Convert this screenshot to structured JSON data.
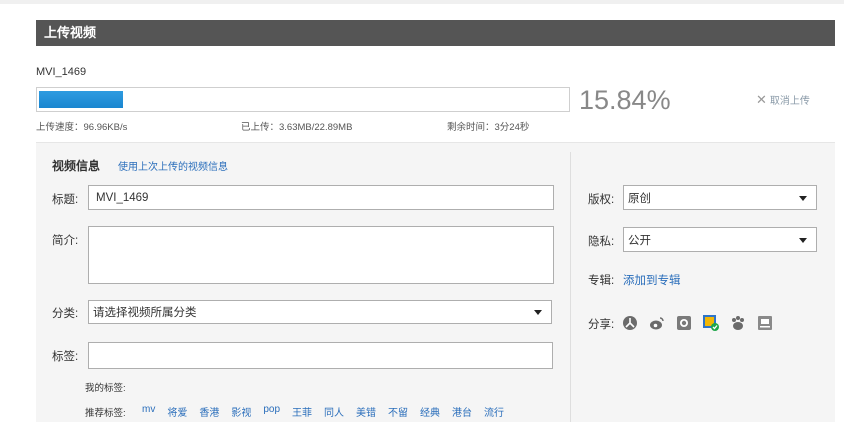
{
  "header": {
    "title": "上传视频"
  },
  "upload": {
    "file_name": "MVI_1469",
    "progress_fraction": 0.1584,
    "percent_text": "15.84%",
    "cancel_label": "取消上传",
    "speed_text": "上传速度：96.96KB/s",
    "uploaded_text": "已上传：3.63MB/22.89MB",
    "remaining_text": "剩余时间：3分24秒"
  },
  "form": {
    "section_title": "视频信息",
    "reuse_link": "使用上次上传的视频信息",
    "title_label": "标题:",
    "title_value": "MVI_1469",
    "desc_label": "简介:",
    "desc_value": "",
    "category_label": "分类:",
    "category_value": "请选择视频所属分类",
    "tags_label": "标签:",
    "tags_value": "",
    "my_tags_label": "我的标签:",
    "recommended_label": "推荐标签:",
    "recommended_tags": [
      "mv",
      "将爱",
      "香港",
      "影视",
      "pop",
      "王菲",
      "同人",
      "美错",
      "不留",
      "经典",
      "港台",
      "流行"
    ]
  },
  "side": {
    "copyright_label": "版权:",
    "copyright_value": "原创",
    "privacy_label": "隐私:",
    "privacy_value": "公开",
    "album_label": "专辑:",
    "album_link": "添加到专辑",
    "share_label": "分享:",
    "share_icons": [
      "renren-icon",
      "weibo-icon",
      "qzone-icon",
      "kaixin-icon",
      "baidu-icon",
      "douban-icon"
    ]
  },
  "colors": {
    "header_bg": "#555555",
    "progress_fill": "#1a86d0",
    "link": "#2a6ebb",
    "panel_bg": "#f5f5f5"
  }
}
